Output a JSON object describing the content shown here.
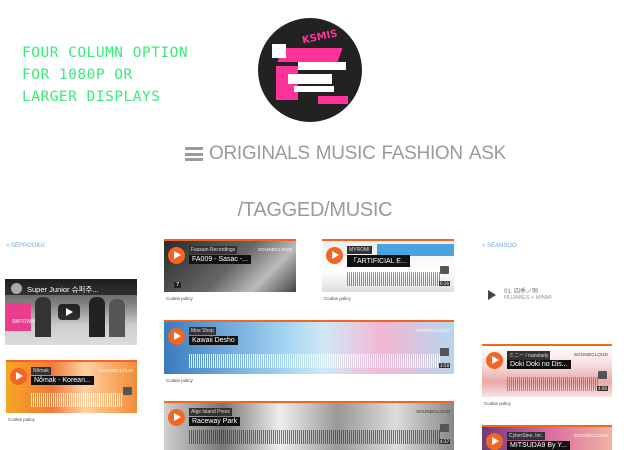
{
  "promo": {
    "lines": [
      "FOUR COLUMN OPTION",
      "FOR 1080P OR",
      "LARGER DISPLAYS"
    ]
  },
  "logo": {
    "text": "KSMIS"
  },
  "nav": {
    "items": [
      "ORIGINALS",
      "MUSIC",
      "FASHION",
      "ASK"
    ]
  },
  "page_title": "/TAGGED/MUSIC",
  "sidebar": {
    "left_link": "« SEPPOOKU",
    "right_link": "« SEANSOO"
  },
  "video": {
    "title": "Super Junior 슈퍼주...",
    "channel_label": "SMTOWN"
  },
  "soundcloud_label": "SOUNDCLOUD",
  "cookie_label": "Cookie policy",
  "embeds": [
    {
      "artist": "Fassain Recordings",
      "track": "FA009 - Sasac -...",
      "time": "7"
    },
    {
      "artist": "MYROMI",
      "track": "「ARTIFICIAL E...",
      "time": "6:26"
    },
    {
      "artist": "Moe Shop",
      "track": "Kawaii Desho",
      "time": "3:58"
    },
    {
      "artist": "Nômak",
      "track": "Nômak - Korean...",
      "time": ""
    },
    {
      "artist": "Alge Island Press",
      "track": "Raceway Park",
      "time": "4:37"
    },
    {
      "artist": "ミニー / nanolady",
      "track": "Doki Doki no Dis...",
      "time": "4:06"
    },
    {
      "artist": "CyberSine, Inc.",
      "track": "MITSUDA9 By Y...",
      "time": ""
    }
  ],
  "audio": {
    "title": "01. 四季ノ唄",
    "artist": "NUJABES + MINMI"
  },
  "colors": {
    "accent_orange": "#f26522",
    "promo_green": "#33ee77",
    "nav_gray": "#9a9a9a",
    "link_blue": "#6fa8dc"
  }
}
